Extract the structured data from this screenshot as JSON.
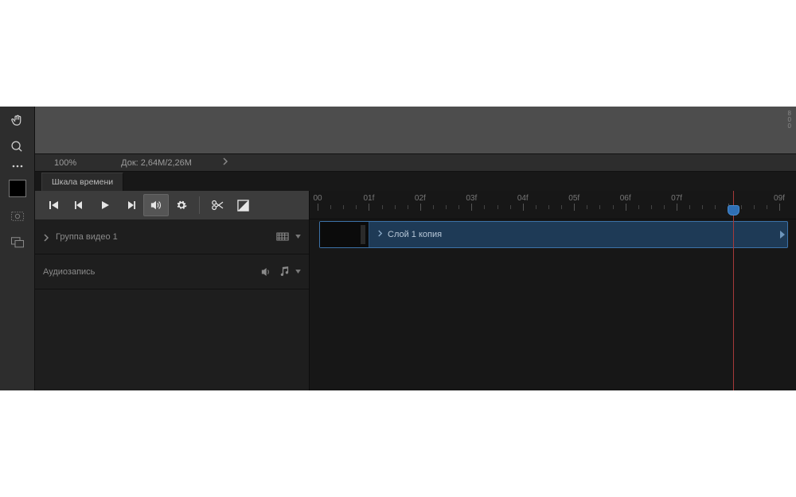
{
  "tools": {
    "hand": "hand-icon",
    "zoom": "zoom-icon",
    "swatch": "color-swatch",
    "crop": "crop-icon",
    "artboards": "artboards-icon"
  },
  "canvas": {
    "tick_vals": "8\n0\n0"
  },
  "status": {
    "zoom": "100%",
    "doc_size": "Док: 2,64M/2,26M"
  },
  "timeline": {
    "tab_label": "Шкала времени",
    "ruler_labels": [
      "00",
      "01f",
      "02f",
      "03f",
      "04f",
      "05f",
      "06f",
      "07f",
      "",
      "09f"
    ],
    "playhead_frame": 8.1,
    "track": {
      "name": "Группа видео 1",
      "clip_label": "Слой 1 копия"
    },
    "audio": {
      "label": "Аудиозапись"
    }
  }
}
